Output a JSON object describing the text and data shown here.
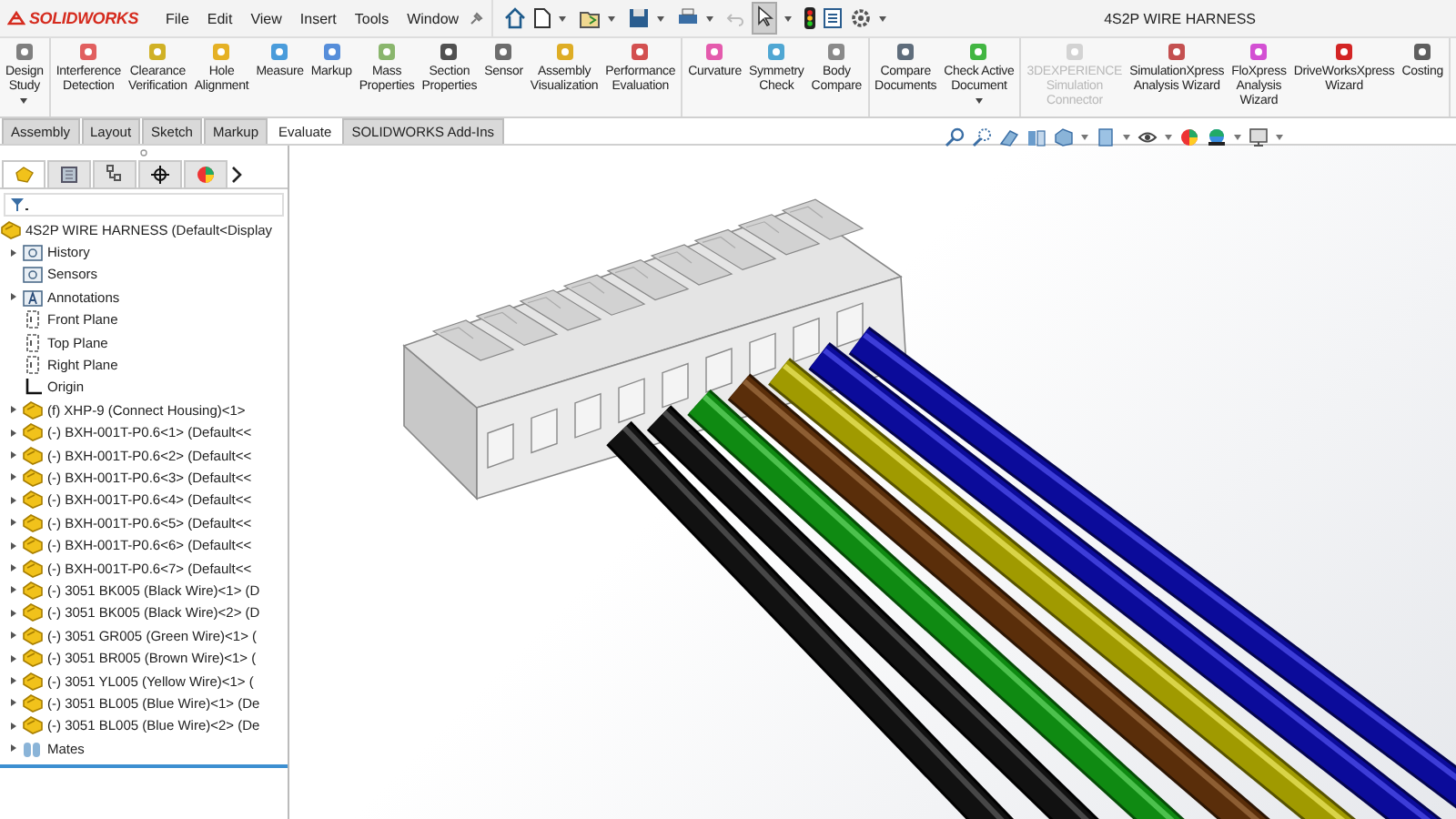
{
  "app": {
    "logo": "SOLIDWORKS",
    "menu": [
      "File",
      "Edit",
      "View",
      "Insert",
      "Tools",
      "Window"
    ],
    "document_title": "4S2P WIRE HARNESS"
  },
  "ribbon": {
    "groups": [
      {
        "buttons": [
          {
            "label": "Design\nStudy",
            "dropdown": true,
            "disabled": false
          }
        ]
      },
      {
        "buttons": [
          {
            "label": "Interference\nDetection",
            "dropdown": false,
            "disabled": false
          },
          {
            "label": "Clearance\nVerification",
            "dropdown": false,
            "disabled": false
          },
          {
            "label": "Hole\nAlignment",
            "dropdown": false,
            "disabled": false
          },
          {
            "label": "Measure",
            "dropdown": false,
            "disabled": false
          },
          {
            "label": "Markup",
            "dropdown": false,
            "disabled": false
          },
          {
            "label": "Mass\nProperties",
            "dropdown": false,
            "disabled": false
          },
          {
            "label": "Section\nProperties",
            "dropdown": false,
            "disabled": false
          },
          {
            "label": "Sensor",
            "dropdown": false,
            "disabled": false
          },
          {
            "label": "Assembly\nVisualization",
            "dropdown": false,
            "disabled": false
          },
          {
            "label": "Performance\nEvaluation",
            "dropdown": false,
            "disabled": false
          }
        ]
      },
      {
        "buttons": [
          {
            "label": "Curvature",
            "dropdown": false,
            "disabled": false
          },
          {
            "label": "Symmetry\nCheck",
            "dropdown": false,
            "disabled": false
          },
          {
            "label": "Body\nCompare",
            "dropdown": false,
            "disabled": false
          }
        ]
      },
      {
        "buttons": [
          {
            "label": "Compare\nDocuments",
            "dropdown": false,
            "disabled": false
          },
          {
            "label": "Check Active\nDocument",
            "dropdown": true,
            "disabled": false
          }
        ]
      },
      {
        "buttons": [
          {
            "label": "3DEXPERIENCE\nSimulation\nConnector",
            "dropdown": false,
            "disabled": true
          },
          {
            "label": "SimulationXpress\nAnalysis Wizard",
            "dropdown": false,
            "disabled": false
          },
          {
            "label": "FloXpress\nAnalysis\nWizard",
            "dropdown": false,
            "disabled": false
          },
          {
            "label": "DriveWorksXpress\nWizard",
            "dropdown": false,
            "disabled": false
          },
          {
            "label": "Costing",
            "dropdown": false,
            "disabled": false
          }
        ]
      }
    ]
  },
  "tabs": [
    {
      "label": "Assembly",
      "selected": false
    },
    {
      "label": "Layout",
      "selected": false
    },
    {
      "label": "Sketch",
      "selected": false
    },
    {
      "label": "Markup",
      "selected": false
    },
    {
      "label": "Evaluate",
      "selected": true
    },
    {
      "label": "SOLIDWORKS Add-Ins",
      "selected": false
    }
  ],
  "panel_tabs": [
    {
      "selected": true
    },
    {
      "selected": false
    },
    {
      "selected": false
    },
    {
      "selected": false
    },
    {
      "selected": false
    }
  ],
  "tree": {
    "label": "4S2P WIRE HARNESS  (Default<Display",
    "kind": "assembly",
    "children": [
      {
        "label": "History",
        "kind": "folder",
        "expandable": true
      },
      {
        "label": "Sensors",
        "kind": "folder",
        "expandable": false
      },
      {
        "label": "Annotations",
        "kind": "annotations",
        "expandable": true
      },
      {
        "label": "Front Plane",
        "kind": "plane",
        "expandable": false
      },
      {
        "label": "Top Plane",
        "kind": "plane",
        "expandable": false
      },
      {
        "label": "Right Plane",
        "kind": "plane",
        "expandable": false
      },
      {
        "label": "Origin",
        "kind": "origin",
        "expandable": false
      },
      {
        "label": "(f) XHP-9 (Connect Housing)<1>",
        "kind": "part",
        "expandable": true
      },
      {
        "label": "(-) BXH-001T-P0.6<1> (Default<<",
        "kind": "part",
        "expandable": true
      },
      {
        "label": "(-) BXH-001T-P0.6<2> (Default<<",
        "kind": "part",
        "expandable": true
      },
      {
        "label": "(-) BXH-001T-P0.6<3> (Default<<",
        "kind": "part",
        "expandable": true
      },
      {
        "label": "(-) BXH-001T-P0.6<4> (Default<<",
        "kind": "part",
        "expandable": true
      },
      {
        "label": "(-) BXH-001T-P0.6<5> (Default<<",
        "kind": "part",
        "expandable": true
      },
      {
        "label": "(-) BXH-001T-P0.6<6> (Default<<",
        "kind": "part",
        "expandable": true
      },
      {
        "label": "(-) BXH-001T-P0.6<7> (Default<<",
        "kind": "part",
        "expandable": true
      },
      {
        "label": "(-) 3051 BK005 (Black Wire)<1> (D",
        "kind": "part",
        "expandable": true
      },
      {
        "label": "(-) 3051 BK005 (Black Wire)<2> (D",
        "kind": "part",
        "expandable": true
      },
      {
        "label": "(-) 3051 GR005 (Green Wire)<1> (",
        "kind": "part",
        "expandable": true
      },
      {
        "label": "(-) 3051 BR005 (Brown Wire)<1> (",
        "kind": "part",
        "expandable": true
      },
      {
        "label": "(-) 3051 YL005 (Yellow Wire)<1> (",
        "kind": "part",
        "expandable": true
      },
      {
        "label": "(-) 3051 BL005 (Blue Wire)<1> (De",
        "kind": "part",
        "expandable": true
      },
      {
        "label": "(-) 3051 BL005 (Blue Wire)<2> (De",
        "kind": "part",
        "expandable": true
      },
      {
        "label": "Mates",
        "kind": "mates",
        "expandable": true
      }
    ]
  }
}
